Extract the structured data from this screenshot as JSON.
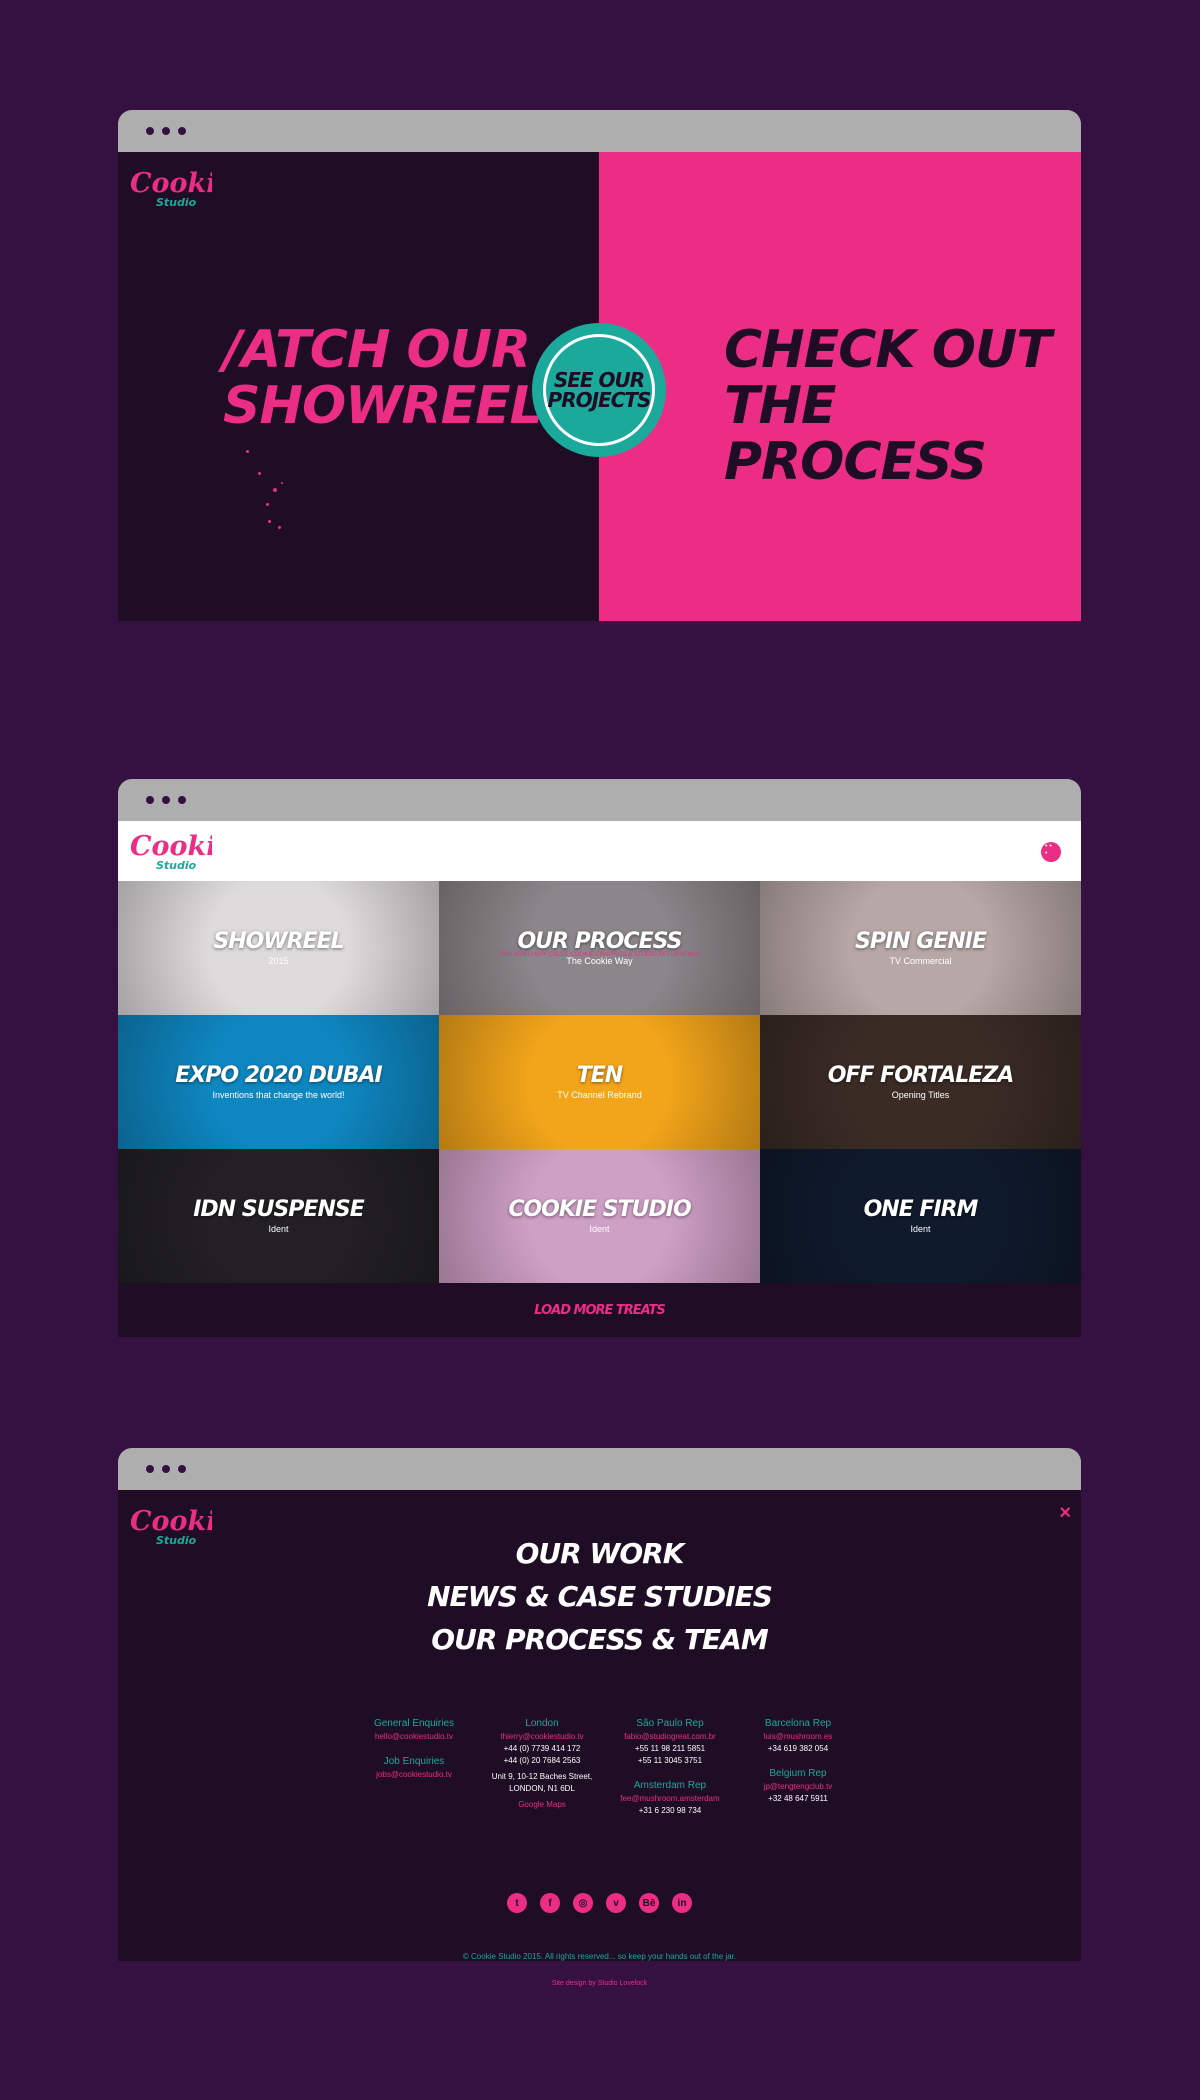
{
  "colors": {
    "background": "#351142",
    "dark": "#1e0d24",
    "pink": "#ec2d85",
    "teal": "#1aa99a",
    "chrome": "#aeaeae"
  },
  "logo": {
    "word": "Cookie",
    "sub": "Studio"
  },
  "hero": {
    "left_line1": "/ATCH OUR",
    "left_line2": "SHOWREEL",
    "right_line1": "CHECK OUT",
    "right_line2": "THE PROCESS",
    "badge_line1": "SEE OUR",
    "badge_line2": "PROJECTS"
  },
  "projects": [
    {
      "title": "SHOWREEL",
      "sub": "2015",
      "note": "",
      "color": "#dedbdc"
    },
    {
      "title": "OUR PROCESS",
      "sub": "The Cookie Way",
      "note": "THIS VIDEO MAY CAUSE COOKIE CRAVINGS & STUDIO RECURRENCE",
      "color": "#8c8589"
    },
    {
      "title": "SPIN GENIE",
      "sub": "TV Commercial",
      "note": "",
      "color": "#b7a7a6"
    },
    {
      "title": "EXPO 2020 DUBAI",
      "sub": "Inventions that change the world!",
      "note": "",
      "color": "#0e86c0"
    },
    {
      "title": "TEN",
      "sub": "TV Channel Rebrand",
      "note": "",
      "color": "#f3a51a"
    },
    {
      "title": "OFF FORTALEZA",
      "sub": "Opening Titles",
      "note": "",
      "color": "#3a2b25"
    },
    {
      "title": "IDN SUSPENSE",
      "sub": "Ident",
      "note": "",
      "color": "#222024"
    },
    {
      "title": "COOKIE STUDIO",
      "sub": "Ident",
      "note": "",
      "color": "#cfa0c6"
    },
    {
      "title": "ONE FIRM",
      "sub": "Ident",
      "note": "",
      "color": "#0f1a2c"
    }
  ],
  "load_more": "LOAD MORE TREATS",
  "menu": [
    "OUR WORK",
    "NEWS & CASE STUDIES",
    "OUR PROCESS & TEAM"
  ],
  "close_icon": "×",
  "contacts": [
    {
      "blocks": [
        {
          "heading": "General Enquiries",
          "lines": [
            {
              "t": "hello@cookiestudio.tv",
              "c": "pink"
            }
          ]
        },
        {
          "heading": "Job Enquiries",
          "lines": [
            {
              "t": "jobs@cookiestudio.tv",
              "c": "pink"
            }
          ]
        }
      ]
    },
    {
      "blocks": [
        {
          "heading": "London",
          "lines": [
            {
              "t": "thierry@cookiestudio.tv",
              "c": "pink"
            },
            {
              "t": "+44 (0) 7739 414 172",
              "c": "white"
            },
            {
              "t": "+44 (0) 20 7684 2563",
              "c": "white"
            },
            {
              "t": "",
              "c": "white"
            },
            {
              "t": "Unit 9, 10-12 Baches Street,",
              "c": "white"
            },
            {
              "t": "LONDON, N1 6DL",
              "c": "white"
            },
            {
              "t": "",
              "c": "white"
            },
            {
              "t": "Google Maps",
              "c": "pink"
            }
          ]
        }
      ]
    },
    {
      "blocks": [
        {
          "heading": "São Paulo Rep",
          "lines": [
            {
              "t": "fabio@studiogreat.com.br",
              "c": "pink"
            },
            {
              "t": "+55 11 98 211 5851",
              "c": "white"
            },
            {
              "t": "+55 11 3045 3751",
              "c": "white"
            }
          ]
        },
        {
          "heading": "Amsterdam Rep",
          "lines": [
            {
              "t": "fee@mushroom.amsterdam",
              "c": "pink"
            },
            {
              "t": "+31 6 230 98 734",
              "c": "white"
            }
          ]
        }
      ]
    },
    {
      "blocks": [
        {
          "heading": "Barcelona Rep",
          "lines": [
            {
              "t": "luis@mushroom.es",
              "c": "pink"
            },
            {
              "t": "+34 619 382 054",
              "c": "white"
            }
          ]
        },
        {
          "heading": "Belgium Rep",
          "lines": [
            {
              "t": "jp@tengtengclub.tv",
              "c": "pink"
            },
            {
              "t": "+32 48 647 5911",
              "c": "white"
            }
          ]
        }
      ]
    }
  ],
  "social": [
    {
      "name": "twitter-icon",
      "glyph": "t"
    },
    {
      "name": "facebook-icon",
      "glyph": "f"
    },
    {
      "name": "instagram-icon",
      "glyph": "◎"
    },
    {
      "name": "vimeo-icon",
      "glyph": "v"
    },
    {
      "name": "behance-icon",
      "glyph": "Bē"
    },
    {
      "name": "linkedin-icon",
      "glyph": "in"
    }
  ],
  "copyright": "© Cookie Studio 2015. All rights reserved... so keep your hands out of the jar.",
  "credit": "Site design by Studio Lovelock"
}
